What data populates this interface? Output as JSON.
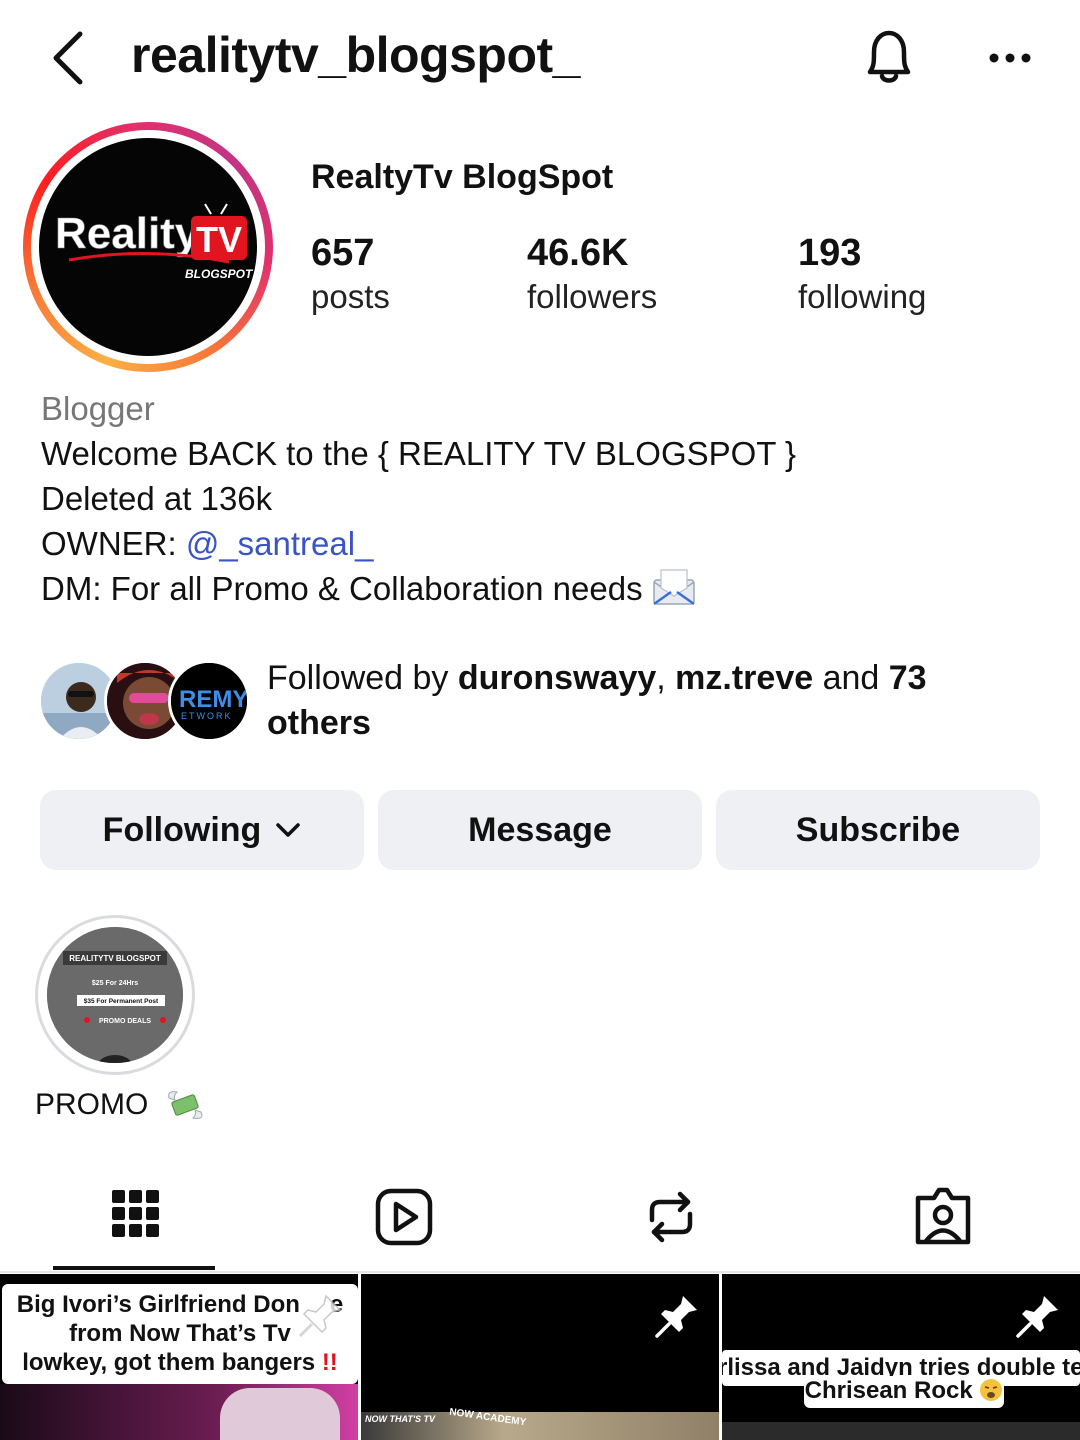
{
  "header": {
    "username": "realitytv_blogspot_"
  },
  "profile": {
    "display_name": "RealtyTv BlogSpot",
    "avatar_logo": {
      "word1": "Reality",
      "word2": "TV",
      "word3": "BLOGSPOT"
    },
    "stats": [
      {
        "value": "657",
        "label": "posts"
      },
      {
        "value": "46.6K",
        "label": "followers"
      },
      {
        "value": "193",
        "label": "following"
      }
    ]
  },
  "bio": {
    "category": "Blogger",
    "line1": "Welcome BACK to the { REALITY TV BLOGSPOT }",
    "line2": "Deleted at 136k",
    "line3_prefix": "OWNER: ",
    "line3_mention": "@_santreal_",
    "line4": "DM: For all Promo & Collaboration needs"
  },
  "followed_by": {
    "prefix": "Followed by ",
    "user1": "duronswayy",
    "sep": ", ",
    "user2": "mz.treve",
    "mid": " and ",
    "count": "73",
    "suffix": "others",
    "avatar3_text": "REMY",
    "avatar3_sub": "ETWORK"
  },
  "actions": {
    "following": "Following",
    "message": "Message",
    "subscribe": "Subscribe"
  },
  "highlights": [
    {
      "label": "PROMO",
      "thumb_title": "REALITYTV BLOGSPOT",
      "thumb_line1": "$25 For 24Hrs",
      "thumb_line2": "$35 For Permanent Post",
      "thumb_line3": "PROMO DEALS"
    }
  ],
  "tabs": [
    "grid-icon",
    "reels-icon",
    "reposts-icon",
    "tagged-icon"
  ],
  "posts": [
    {
      "caption_l1": "Big Ivori’s Girlfriend Don",
      "caption_l1_tail": "e",
      "caption_l2": "from Now That’s Tv",
      "caption_l3": "lowkey, got them bangers",
      "caption_mark": "!!"
    },
    {
      "strip_text1": "NOW THAT'S TV",
      "strip_text2": "NOW ACADEMY"
    },
    {
      "caption_l1": "rlissa and Jaidyn tries double te",
      "caption_l2": "Chrisean Rock"
    }
  ],
  "colors": {
    "mention": "#3a54c6",
    "button_bg": "#eef0f3",
    "accent_red": "#e0151f"
  }
}
